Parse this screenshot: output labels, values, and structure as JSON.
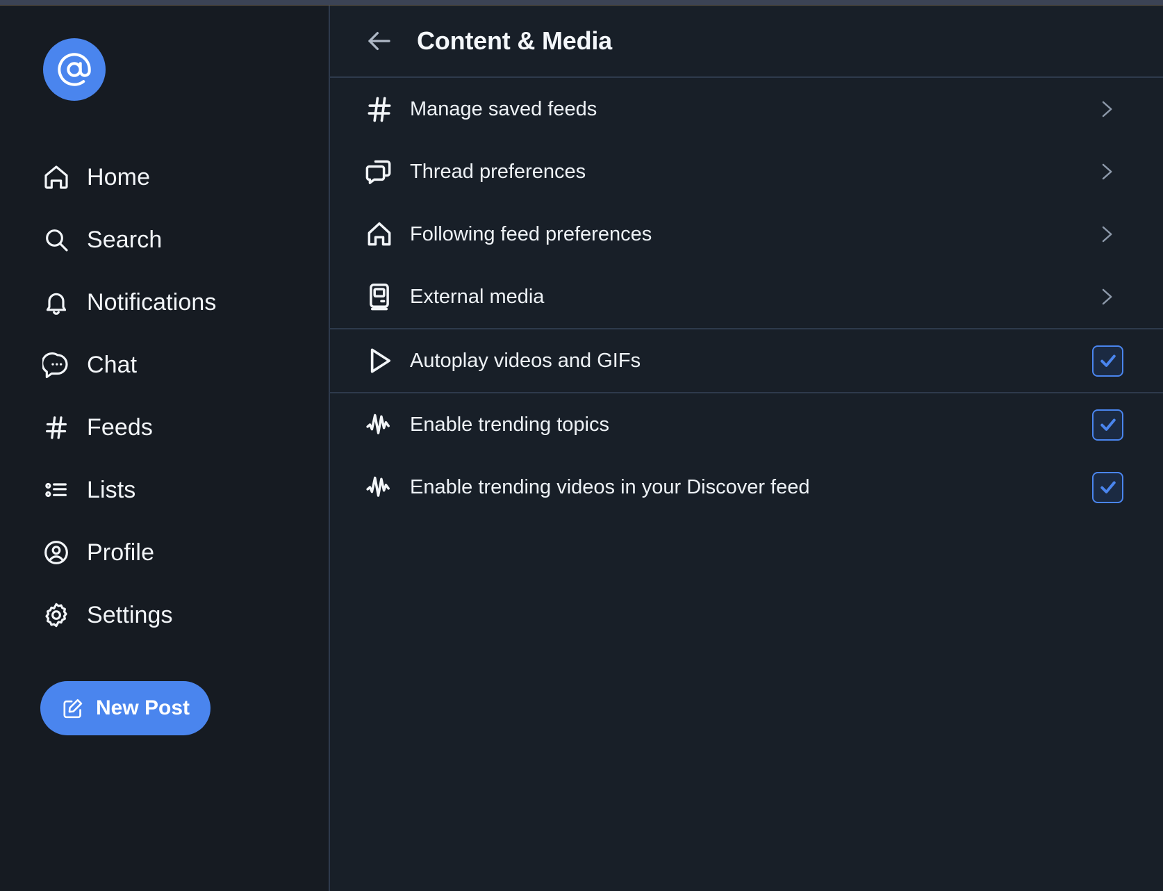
{
  "colors": {
    "accent": "#4a85ee",
    "sidebar_bg": "#161b22",
    "main_bg": "#181f28",
    "divider": "#2e3a4c",
    "text_primary": "#f2f5f8",
    "chevron": "#8d99aa",
    "checkbox_fill": "#1b2a42"
  },
  "sidebar": {
    "avatar": {
      "glyph": "@",
      "icon": "at-sign-icon"
    },
    "items": [
      {
        "label": "Home",
        "icon": "home-icon"
      },
      {
        "label": "Search",
        "icon": "search-icon"
      },
      {
        "label": "Notifications",
        "icon": "bell-icon"
      },
      {
        "label": "Chat",
        "icon": "chat-bubble-icon"
      },
      {
        "label": "Feeds",
        "icon": "hash-icon"
      },
      {
        "label": "Lists",
        "icon": "list-icon"
      },
      {
        "label": "Profile",
        "icon": "user-circle-icon"
      },
      {
        "label": "Settings",
        "icon": "gear-icon"
      }
    ],
    "new_post": {
      "label": "New Post",
      "icon": "compose-icon"
    }
  },
  "header": {
    "back_icon": "arrow-left-icon",
    "title": "Content & Media"
  },
  "groups": [
    {
      "rows": [
        {
          "label": "Manage saved feeds",
          "icon": "hash-icon",
          "control": "chevron"
        },
        {
          "label": "Thread preferences",
          "icon": "threads-icon",
          "control": "chevron"
        },
        {
          "label": "Following feed preferences",
          "icon": "home-icon",
          "control": "chevron"
        },
        {
          "label": "External media",
          "icon": "external-media-icon",
          "control": "chevron"
        }
      ]
    },
    {
      "rows": [
        {
          "label": "Autoplay videos and GIFs",
          "icon": "play-icon",
          "control": "checkbox",
          "checked": true
        }
      ]
    },
    {
      "rows": [
        {
          "label": "Enable trending topics",
          "icon": "trending-pulse-icon",
          "control": "checkbox",
          "checked": true
        },
        {
          "label": "Enable trending videos in your Discover feed",
          "icon": "trending-pulse-icon",
          "control": "checkbox",
          "checked": true
        }
      ]
    }
  ]
}
